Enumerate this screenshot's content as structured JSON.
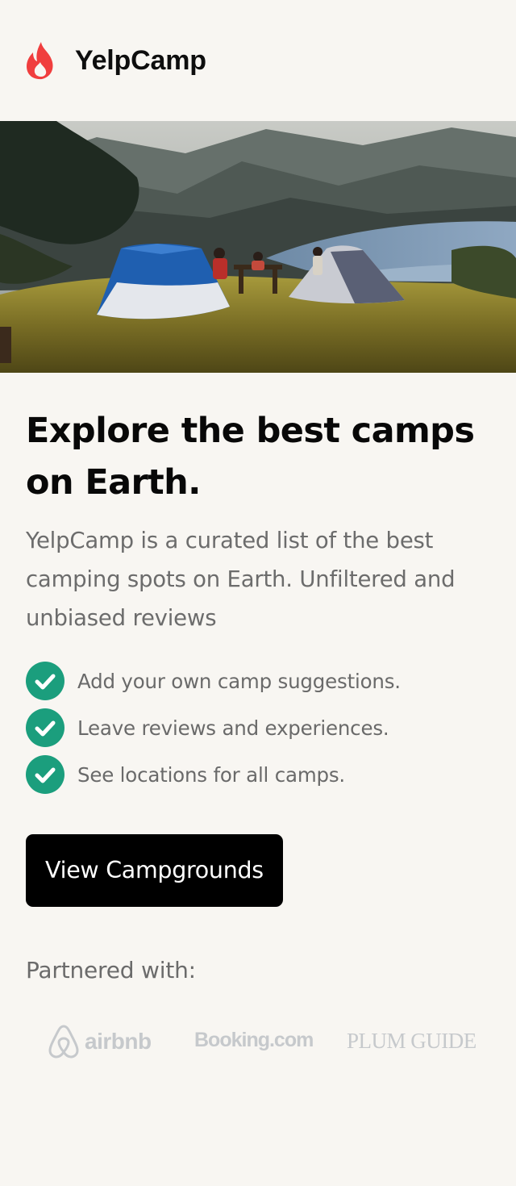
{
  "header": {
    "brand": "YelpCamp",
    "logo_icon": "flame-icon",
    "brand_color": "#f03e3e"
  },
  "hero": {
    "image_icon": "camping-tents-photo"
  },
  "main": {
    "headline": "Explore the best camps on Earth.",
    "intro": "YelpCamp is a curated list of the best camping spots on Earth. Unfiltered and unbiased reviews",
    "features": [
      {
        "icon": "check-circle-icon",
        "label": "Add your own camp suggestions."
      },
      {
        "icon": "check-circle-icon",
        "label": "Leave reviews and experiences."
      },
      {
        "icon": "check-circle-icon",
        "label": "See locations for all camps."
      }
    ],
    "check_color": "#1b9e7d",
    "cta_label": "View Campgrounds"
  },
  "partners": {
    "label": "Partnered with:",
    "logos": [
      {
        "name": "airbnb",
        "icon": "airbnb-logo-icon"
      },
      {
        "name": "Booking.com"
      },
      {
        "name": "PLUM GUIDE"
      }
    ]
  }
}
